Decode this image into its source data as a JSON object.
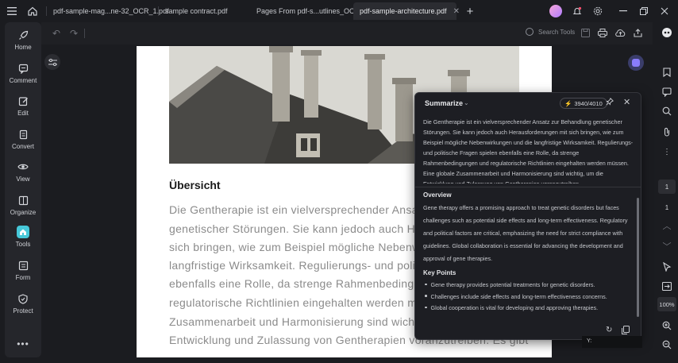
{
  "tabs": [
    {
      "label": "pdf-sample-mag...ne-32_OCR_1.pdf",
      "active": false
    },
    {
      "label": "sample contract.pdf",
      "active": false
    },
    {
      "label": "Pages From pdf-s...utlines_OCR.pdf",
      "active": false
    },
    {
      "label": "pdf-sample-architecture.pdf",
      "active": true
    }
  ],
  "sidebar": {
    "items": [
      {
        "label": "Home",
        "icon": "rocket-icon"
      },
      {
        "label": "Comment",
        "icon": "comment-icon"
      },
      {
        "label": "Edit",
        "icon": "edit-icon"
      },
      {
        "label": "Convert",
        "icon": "convert-icon"
      },
      {
        "label": "View",
        "icon": "eye-icon"
      },
      {
        "label": "Organize",
        "icon": "organize-icon"
      },
      {
        "label": "Tools",
        "icon": "tools-icon",
        "active": true
      },
      {
        "label": "Form",
        "icon": "form-icon"
      },
      {
        "label": "Protect",
        "icon": "shield-icon"
      }
    ]
  },
  "toolbar": {
    "search_label": "Search Tools"
  },
  "document": {
    "heading": "Übersicht",
    "lines": [
      "Die Gentherapie ist ein vielversprechender Ansatz",
      "genetischer Störungen. Sie kann jedoch auch Her",
      "sich bringen, wie zum Beispiel mögliche Nebenwi",
      "langfristige Wirksamkeit. Regulierungs- und politis",
      "ebenfalls eine Rolle, da strenge Rahmenbedingun",
      "regulatorische Richtlinien eingehalten werden mü",
      "Zusammenarbeit und Harmonisierung sind wichtig",
      "Entwicklung und Zulassung von Gentherapien voranzutreiben. Es gibt"
    ]
  },
  "panel": {
    "title": "Summarize",
    "credits": "3940/4010",
    "source_text": "Die Gentherapie ist ein vielversprechender Ansatz zur Behandlung genetischer Störungen. Sie kann jedoch auch Herausforderungen mit sich bringen, wie zum Beispiel mögliche Nebenwirkungen und die langfristige Wirksamkeit. Regulierungs- und politische Fragen spielen ebenfalls eine Rolle, da strenge Rahmenbedingungen und regulatorische Richtlinien eingehalten werden müssen. Eine globale Zusammenarbeit und Harmonisierung sind wichtig, um die Entwicklung und Zulassung von Gentherapien voranzutreiben.",
    "overview_title": "Overview",
    "overview_text": "Gene therapy offers a promising approach to treat genetic disorders but faces challenges such as potential side effects and long-term effectiveness. Regulatory and political factors are critical, emphasizing the need for strict compliance with guidelines. Global collaboration is essential for advancing the development and approval of gene therapies.",
    "keypoints_title": "Key Points",
    "keypoints": [
      "Gene therapy provides potential treatments for genetic disorders.",
      "Challenges include side effects and long-term effectiveness concerns.",
      "Global cooperation is vital for developing and approving therapies."
    ]
  },
  "tooltip": {
    "text": "Y:"
  },
  "pages": {
    "current": "1",
    "total": "1"
  },
  "zoom": "100%",
  "colors": {
    "accent": "#46c8d9",
    "credits_bolt": "#f6c343",
    "panel_bg": "#1d1e23"
  }
}
